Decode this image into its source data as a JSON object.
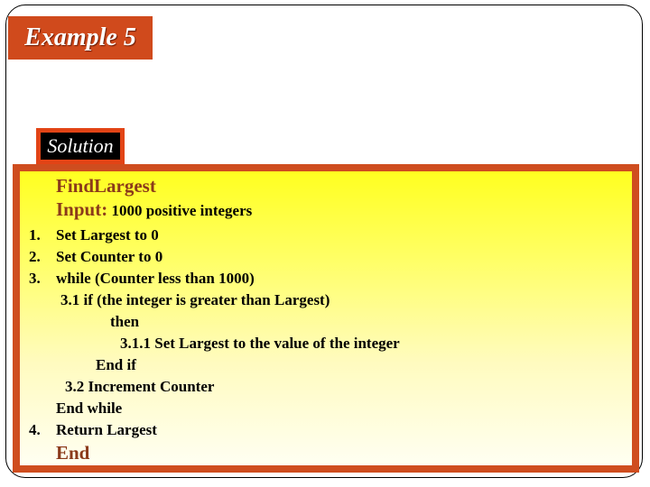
{
  "slide": {
    "title": "Example 5",
    "solution_label": "Solution"
  },
  "algorithm": {
    "name": "FindLargest",
    "input_label": "Input:",
    "input_value": "1000 positive integers",
    "steps": [
      {
        "number": "1.",
        "text": "Set Largest to 0"
      },
      {
        "number": "2.",
        "text": "Set Counter to 0"
      },
      {
        "number": "3.",
        "text": "while (Counter less than 1000)"
      },
      {
        "number": "",
        "text": "3.1  if (the integer is greater than Largest)"
      },
      {
        "number": "",
        "text": "then"
      },
      {
        "number": "",
        "text": "3.1.1  Set Largest to the value of the integer"
      },
      {
        "number": "",
        "text": "End if"
      },
      {
        "number": "",
        "text": "3.2  Increment Counter"
      },
      {
        "number": "",
        "text": "End while"
      },
      {
        "number": "4.",
        "text": "Return Largest"
      }
    ],
    "end_label": "End"
  },
  "colors": {
    "title_bg": "#d04a1c",
    "box_border": "#cf4d1f",
    "heading_text": "#8b3a1a",
    "highlight_yellow": "#ffff20"
  }
}
